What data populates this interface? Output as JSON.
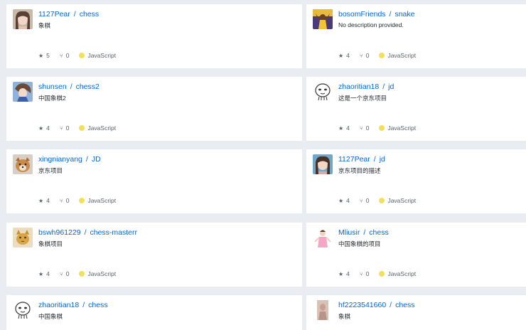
{
  "colors": {
    "link": "#0366d6",
    "javascript": "#f1e05a",
    "background": "#e9edf1"
  },
  "repos": [
    {
      "owner": "1127Pear",
      "name": "chess",
      "description": "象棋",
      "stars": "5",
      "forks": "0",
      "language": "JavaScript",
      "avatar": "girl-portrait"
    },
    {
      "owner": "bosomFriends",
      "name": "snake",
      "description": "No description provided.",
      "stars": "4",
      "forks": "0",
      "language": "JavaScript",
      "avatar": "kobe-photo"
    },
    {
      "owner": "shunsen",
      "name": "chess2",
      "description": "中国象棋2",
      "stars": "4",
      "forks": "0",
      "language": "JavaScript",
      "avatar": "anime-character"
    },
    {
      "owner": "zhaoritian18",
      "name": "jd",
      "description": "这是一个京东项目",
      "stars": "4",
      "forks": "0",
      "language": "JavaScript",
      "avatar": "cartoon-face"
    },
    {
      "owner": "xingnianyang",
      "name": "JD",
      "description": "京东项目",
      "stars": "4",
      "forks": "0",
      "language": "JavaScript",
      "avatar": "dog-photo"
    },
    {
      "owner": "1127Pear",
      "name": "jd",
      "description": "京东项目的描述",
      "stars": "4",
      "forks": "0",
      "language": "JavaScript",
      "avatar": "girl-portrait"
    },
    {
      "owner": "bswh961229",
      "name": "chess-masterr",
      "description": "象棋项目",
      "stars": "4",
      "forks": "0",
      "language": "JavaScript",
      "avatar": "cat-photo"
    },
    {
      "owner": "Mliusir",
      "name": "chess",
      "description": "中国象棋的项目",
      "stars": "4",
      "forks": "0",
      "language": "JavaScript",
      "avatar": "pink-figure"
    },
    {
      "owner": "zhaoritian18",
      "name": "chess",
      "description": "中国象棋",
      "stars": "",
      "forks": "",
      "language": "",
      "avatar": "cartoon-face"
    },
    {
      "owner": "hf2223541660",
      "name": "chess",
      "description": "象棋",
      "stars": "",
      "forks": "",
      "language": "",
      "avatar": "person-photo"
    }
  ]
}
